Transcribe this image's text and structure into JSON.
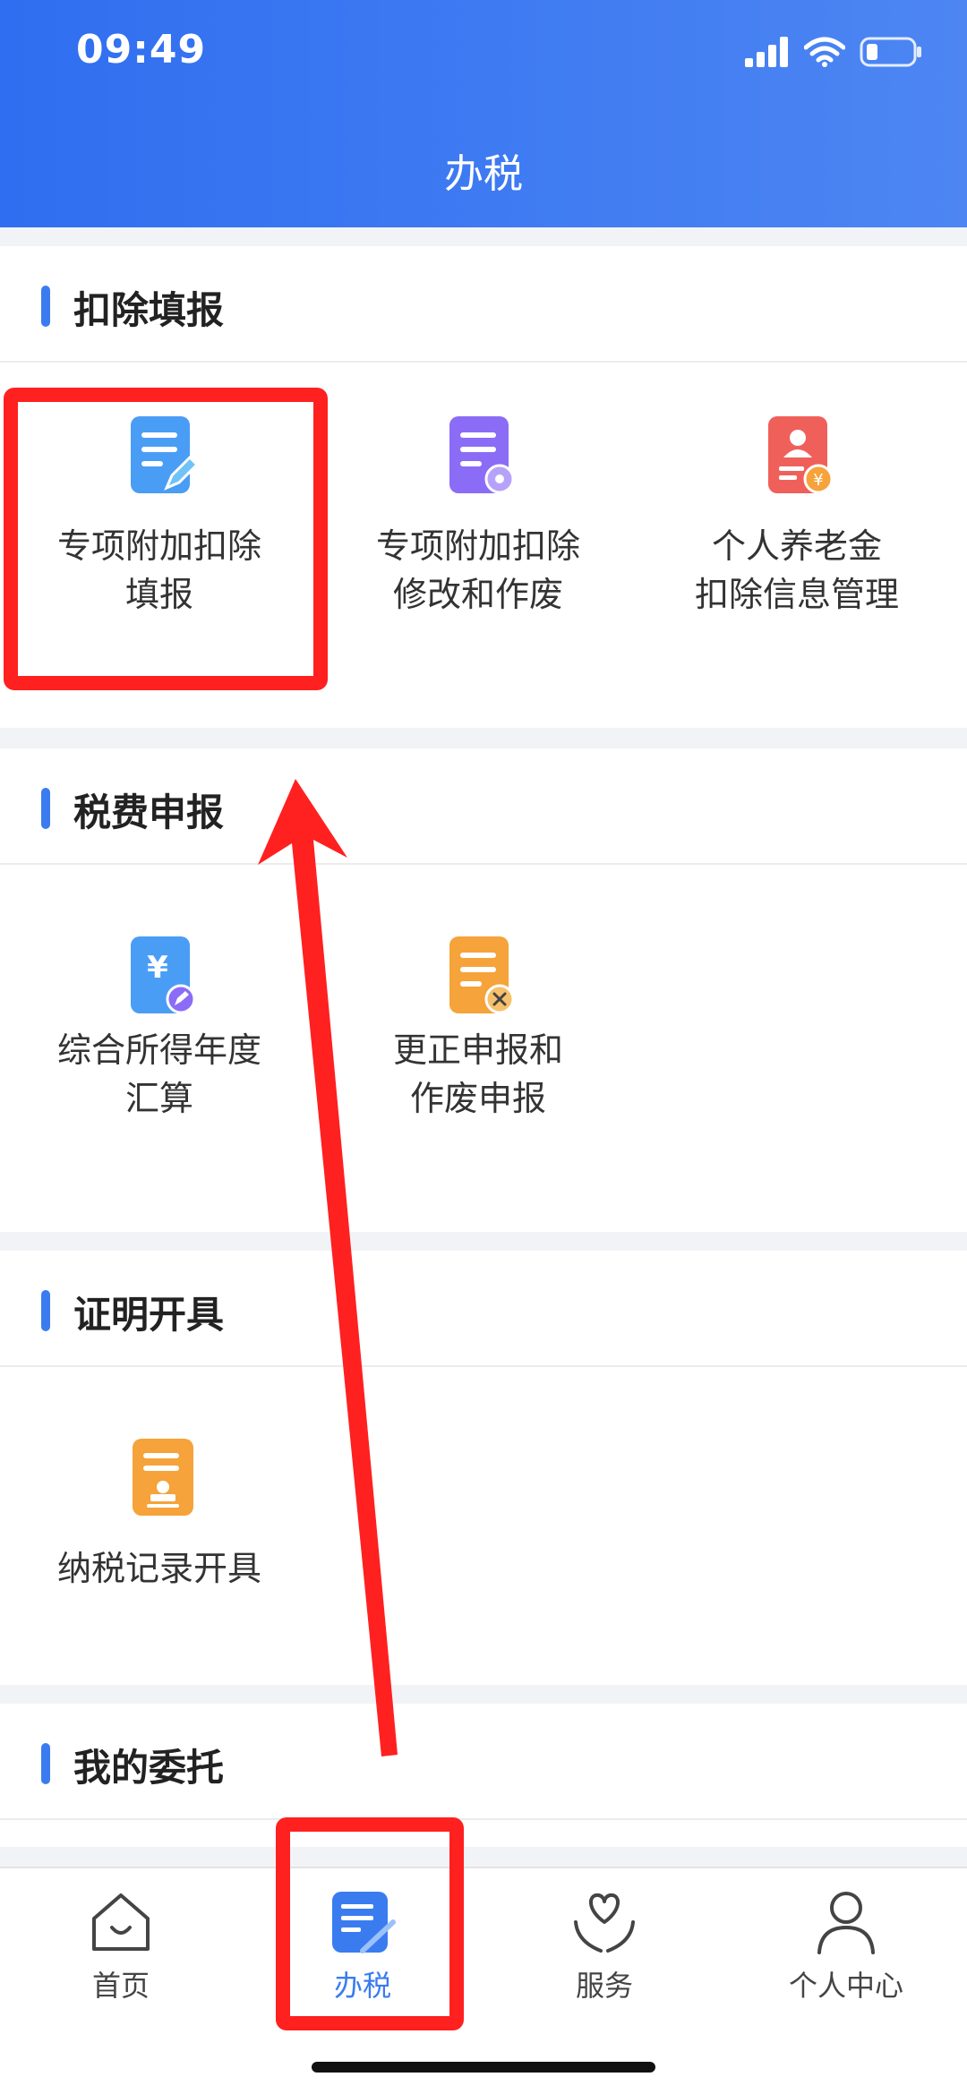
{
  "status_bar": {
    "time": "09:49"
  },
  "header": {
    "title": "办税"
  },
  "sections": [
    {
      "title": "扣除填报",
      "tiles": [
        {
          "label": "专项附加扣除\n填报",
          "icon": "document-edit-icon",
          "color": "#4a9df5"
        },
        {
          "label": "专项附加扣除\n修改和作废",
          "icon": "document-settings-icon",
          "color": "#8b6cf6"
        },
        {
          "label": "个人养老金\n扣除信息管理",
          "icon": "pension-id-card-icon",
          "color": "#f0605a"
        }
      ]
    },
    {
      "title": "税费申报",
      "tiles": [
        {
          "label": "综合所得年度\n汇算",
          "icon": "yuan-document-edit-icon",
          "color": "#4a9df5"
        },
        {
          "label": "更正申报和\n作废申报",
          "icon": "document-cancel-icon",
          "color": "#f5a33a"
        }
      ]
    },
    {
      "title": "证明开具",
      "tiles": [
        {
          "label": "纳税记录开具",
          "icon": "document-stamp-icon",
          "color": "#f5a33a"
        }
      ]
    },
    {
      "title": "我的委托",
      "tiles": []
    }
  ],
  "tabbar": {
    "items": [
      {
        "label": "首页",
        "icon": "home-icon",
        "active": false
      },
      {
        "label": "办税",
        "icon": "tax-document-icon",
        "active": true
      },
      {
        "label": "服务",
        "icon": "heart-hands-icon",
        "active": false
      },
      {
        "label": "个人中心",
        "icon": "person-icon",
        "active": false
      }
    ]
  },
  "colors": {
    "accent": "#3a7cf0",
    "header_start": "#2f6ef0",
    "annotation": "#ff2020"
  }
}
